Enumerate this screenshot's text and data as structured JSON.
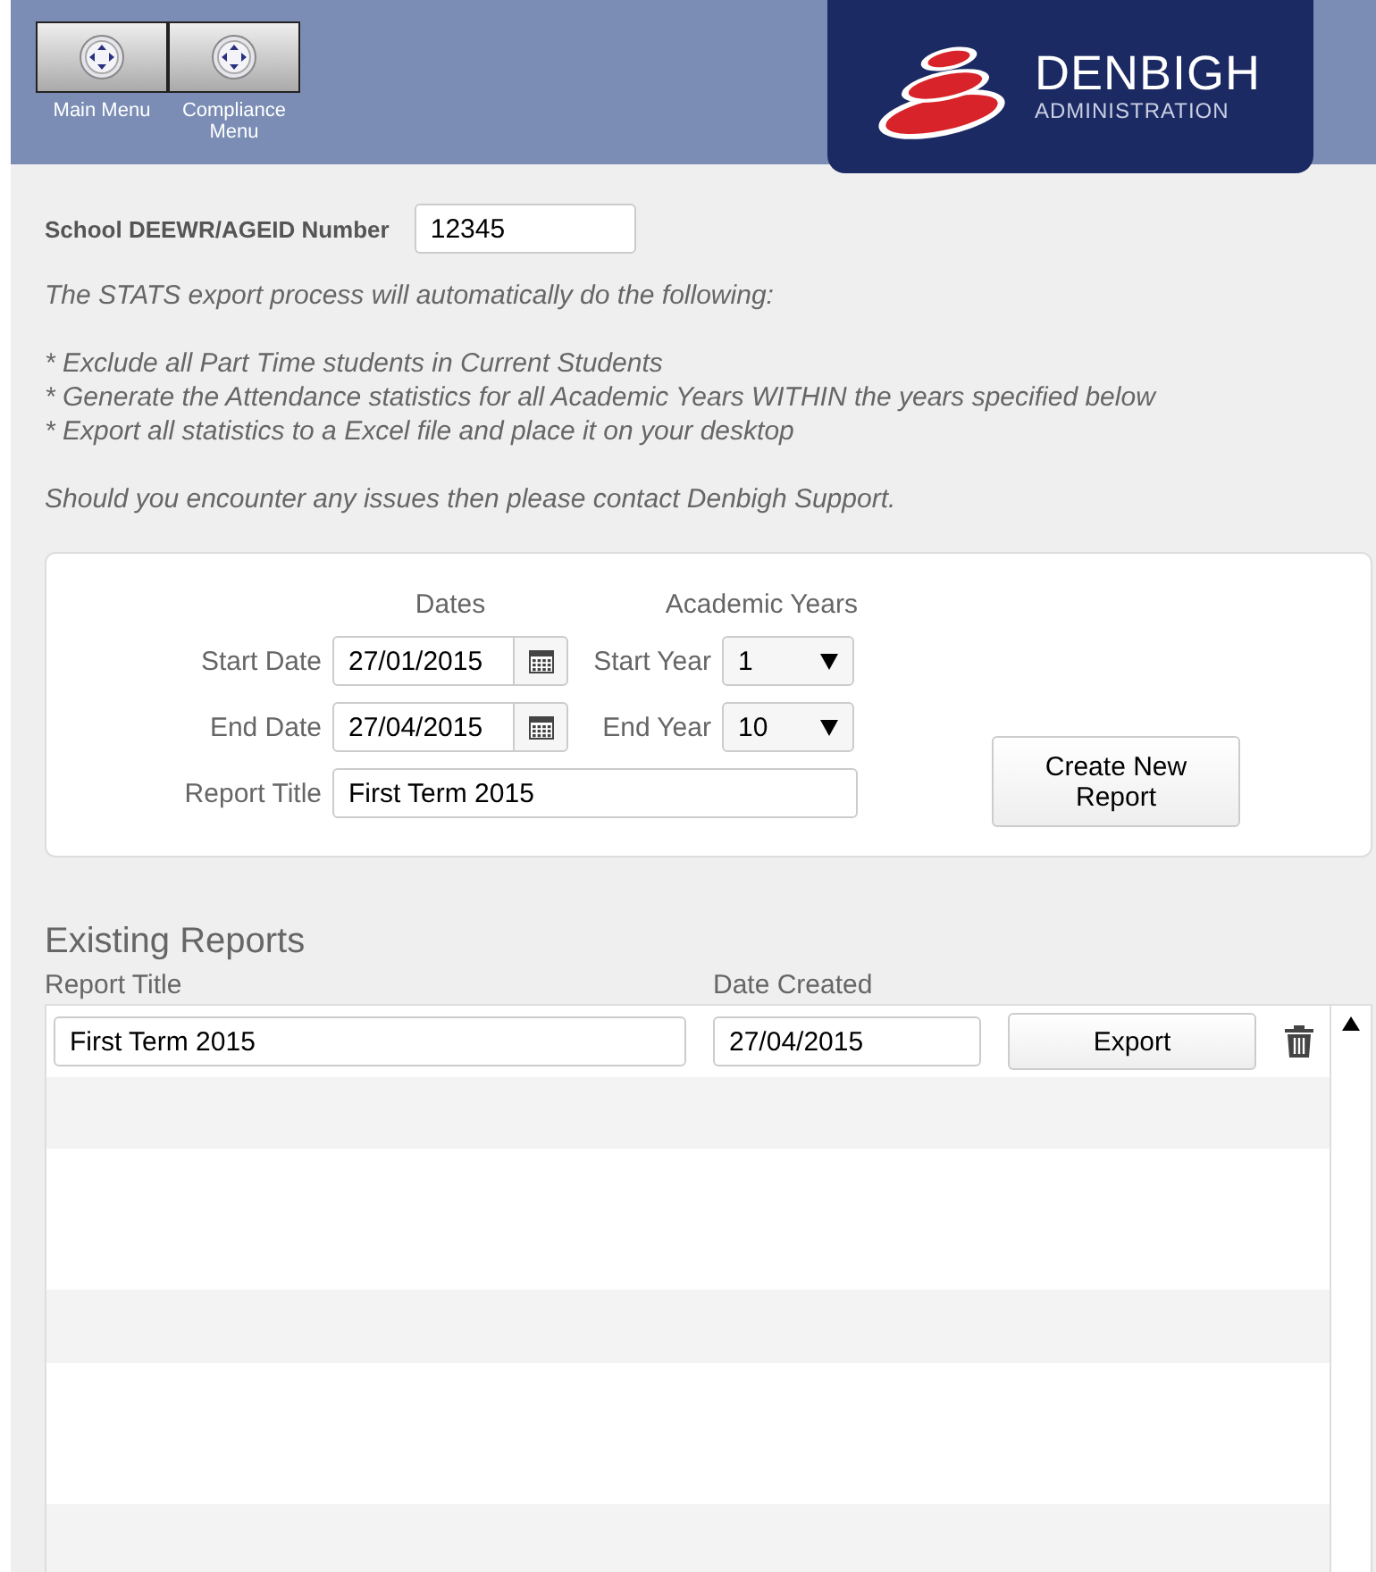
{
  "toolbar": {
    "buttons": [
      {
        "label": "Main Menu"
      },
      {
        "label": "Compliance Menu"
      }
    ]
  },
  "logo": {
    "name": "DENBIGH",
    "tagline": "ADMINISTRATION"
  },
  "school_number": {
    "label": "School DEEWR/AGEID Number",
    "value": "12345"
  },
  "instructions": {
    "intro": "The STATS export process will automatically do the following:",
    "bullets": [
      "* Exclude all Part Time students in Current Students",
      "* Generate the Attendance statistics for all Academic Years WITHIN the years specified below",
      "* Export all statistics to a Excel file and place it on your desktop"
    ],
    "footer": "Should you encounter any issues then please contact Denbigh Support."
  },
  "form": {
    "dates_heading": "Dates",
    "years_heading": "Academic Years",
    "start_date": {
      "label": "Start Date",
      "value": "27/01/2015"
    },
    "end_date": {
      "label": "End Date",
      "value": "27/04/2015"
    },
    "start_year": {
      "label": "Start Year",
      "value": "1"
    },
    "end_year": {
      "label": "End Year",
      "value": "10"
    },
    "report_title": {
      "label": "Report Title",
      "value": "First Term 2015"
    },
    "create_button": "Create New Report"
  },
  "existing_reports": {
    "heading": "Existing Reports",
    "columns": [
      "Report Title",
      "Date Created"
    ],
    "rows": [
      {
        "title": "First Term 2015",
        "date_created": "27/04/2015",
        "export_label": "Export"
      }
    ]
  }
}
